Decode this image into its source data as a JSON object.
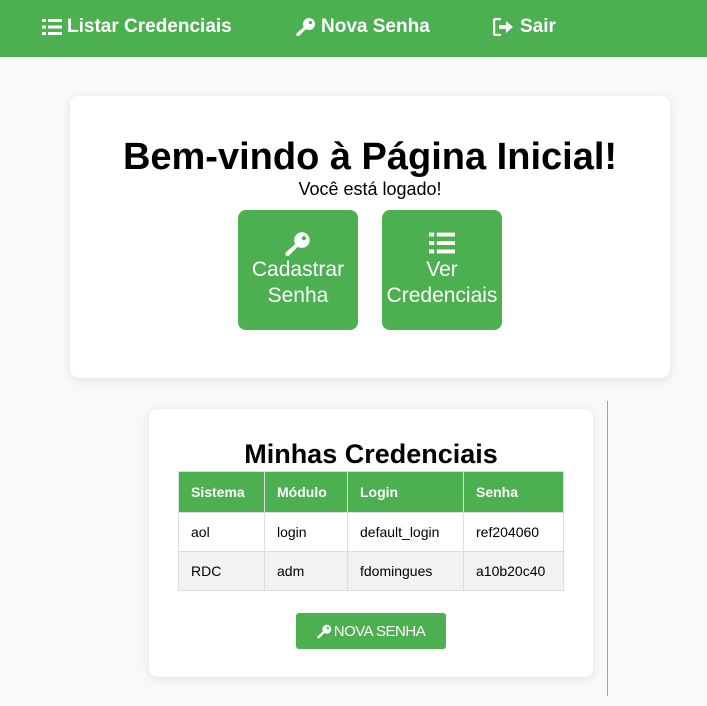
{
  "nav": {
    "list_label": "Listar Credenciais",
    "new_label": "Nova Senha",
    "exit_label": "Sair",
    "list_icon": "list-icon",
    "new_icon": "key-icon",
    "exit_icon": "sign-out-icon"
  },
  "welcome": {
    "title": "Bem-vindo à Página Inicial!",
    "subtitle": "Você está logado!",
    "buttons": [
      {
        "label": "Cadastrar\nSenha",
        "icon": "key-icon"
      },
      {
        "label": "Ver\nCredenciais",
        "icon": "list-icon"
      }
    ]
  },
  "credentials": {
    "title": "Minhas Credenciais",
    "headers": [
      "Sistema",
      "Módulo",
      "Login",
      "Senha"
    ],
    "rows": [
      [
        "aol",
        "login",
        "default_login",
        "ref204060"
      ],
      [
        "RDC",
        "adm",
        "fdomingues",
        "a10b20c40"
      ]
    ],
    "new_button": "NOVA SENHA"
  },
  "colors": {
    "primary": "#4caf50",
    "row_alt": "#f2f2f2",
    "background": "#f9f9f9"
  }
}
